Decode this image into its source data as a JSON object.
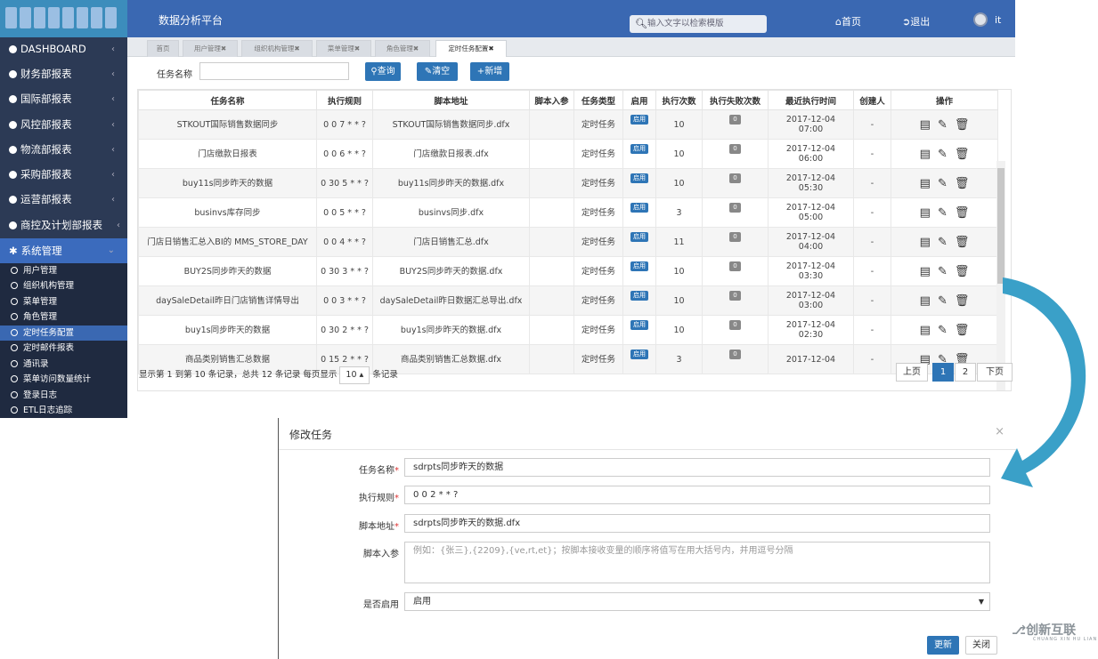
{
  "header": {
    "brand": "数据分析平台",
    "search_placeholder": "输入文字以检索模版",
    "home": "首页",
    "logout": "退出",
    "user": "it"
  },
  "sidebar": {
    "items": [
      {
        "label": "DASHBOARD"
      },
      {
        "label": "财务部报表"
      },
      {
        "label": "国际部报表"
      },
      {
        "label": "风控部报表"
      },
      {
        "label": "物流部报表"
      },
      {
        "label": "采购部报表"
      },
      {
        "label": "运营部报表"
      },
      {
        "label": "商控及计划部报表"
      },
      {
        "label": "系统管理"
      }
    ],
    "sub_items": [
      {
        "label": "用户管理"
      },
      {
        "label": "组织机构管理"
      },
      {
        "label": "菜单管理"
      },
      {
        "label": "角色管理"
      },
      {
        "label": "定时任务配置"
      },
      {
        "label": "定时邮件报表"
      },
      {
        "label": "通讯录"
      },
      {
        "label": "菜单访问数量统计"
      },
      {
        "label": "登录日志"
      },
      {
        "label": "ETL日志追踪"
      }
    ]
  },
  "tabs": [
    {
      "label": "首页"
    },
    {
      "label": "用户管理✖"
    },
    {
      "label": "组织机构管理✖"
    },
    {
      "label": "菜单管理✖"
    },
    {
      "label": "角色管理✖"
    },
    {
      "label": "定时任务配置✖"
    }
  ],
  "toolbar": {
    "label": "任务名称",
    "query": "查询",
    "clear": "清空",
    "add": "新增"
  },
  "table": {
    "headers": [
      "任务名称",
      "执行规则",
      "脚本地址",
      "脚本入参",
      "任务类型",
      "启用",
      "执行次数",
      "执行失败次数",
      "最近执行时间",
      "创建人",
      "操作"
    ],
    "rows": [
      {
        "name": "STKOUT国际销售数据同步",
        "rule": "0 0 7 * * ?",
        "script": "STKOUT国际销售数据同步.dfx",
        "param": "",
        "type": "定时任务",
        "enabled": "启用",
        "count": "10",
        "fail": "0",
        "last1": "2017-12-04",
        "last2": "07:00",
        "creator": "-"
      },
      {
        "name": "门店缴款日报表",
        "rule": "0 0 6 * * ?",
        "script": "门店缴款日报表.dfx",
        "param": "",
        "type": "定时任务",
        "enabled": "启用",
        "count": "10",
        "fail": "0",
        "last1": "2017-12-04",
        "last2": "06:00",
        "creator": "-"
      },
      {
        "name": "buy11s同步昨天的数据",
        "rule": "0 30 5 * * ?",
        "script": "buy11s同步昨天的数据.dfx",
        "param": "",
        "type": "定时任务",
        "enabled": "启用",
        "count": "10",
        "fail": "0",
        "last1": "2017-12-04",
        "last2": "05:30",
        "creator": "-"
      },
      {
        "name": "businvs库存同步",
        "rule": "0 0 5 * * ?",
        "script": "businvs同步.dfx",
        "param": "",
        "type": "定时任务",
        "enabled": "启用",
        "count": "3",
        "fail": "0",
        "last1": "2017-12-04",
        "last2": "05:00",
        "creator": "-"
      },
      {
        "name": "门店日销售汇总入BI的 MMS_STORE_DAY",
        "rule": "0 0 4 * * ?",
        "script": "门店日销售汇总.dfx",
        "param": "",
        "type": "定时任务",
        "enabled": "启用",
        "count": "11",
        "fail": "0",
        "last1": "2017-12-04",
        "last2": "04:00",
        "creator": "-"
      },
      {
        "name": "BUY2S同步昨天的数据",
        "rule": "0 30 3 * * ?",
        "script": "BUY2S同步昨天的数据.dfx",
        "param": "",
        "type": "定时任务",
        "enabled": "启用",
        "count": "10",
        "fail": "0",
        "last1": "2017-12-04",
        "last2": "03:30",
        "creator": "-"
      },
      {
        "name": "daySaleDetail昨日门店销售详情导出",
        "rule": "0 0 3 * * ?",
        "script": "daySaleDetail昨日数据汇总导出.dfx",
        "param": "",
        "type": "定时任务",
        "enabled": "启用",
        "count": "10",
        "fail": "0",
        "last1": "2017-12-04",
        "last2": "03:00",
        "creator": "-"
      },
      {
        "name": "buy1s同步昨天的数据",
        "rule": "0 30 2 * * ?",
        "script": "buy1s同步昨天的数据.dfx",
        "param": "",
        "type": "定时任务",
        "enabled": "启用",
        "count": "10",
        "fail": "0",
        "last1": "2017-12-04",
        "last2": "02:30",
        "creator": "-"
      },
      {
        "name": "商品类别销售汇总数据",
        "rule": "0 15 2 * * ?",
        "script": "商品类别销售汇总数据.dfx",
        "param": "",
        "type": "定时任务",
        "enabled": "启用",
        "count": "3",
        "fail": "0",
        "last1": "2017-12-04",
        "last2": "",
        "creator": "-"
      }
    ]
  },
  "pager": {
    "info_prefix": "显示第 1 到第 10 条记录，总共 12 条记录 每页显示",
    "page_size": "10 ▴",
    "info_suffix": "条记录",
    "prev": "上页",
    "page1": "1",
    "page2": "2",
    "next": "下页"
  },
  "modal": {
    "title": "修改任务",
    "close": "×",
    "name_label": "任务名称",
    "name_value": "sdrpts同步昨天的数据",
    "rule_label": "执行规则",
    "rule_value": "0 0 2 * * ?",
    "script_label": "脚本地址",
    "script_value": "sdrpts同步昨天的数据.dfx",
    "param_label": "脚本入参",
    "param_placeholder": "例如：{张三},{2209},{ve,rt,et}；按脚本接收变量的顺序将值写在用大括号内，并用逗号分隔",
    "enabled_label": "是否启用",
    "enabled_value": "启用",
    "update": "更新",
    "cancel": "关闭",
    "required": "*"
  },
  "watermark": {
    "text": "创新互联",
    "sub": "CHUANG XIN HU LIAN"
  },
  "colors": {
    "topbar": "#3a68b2",
    "sidebar": "#2c3a55",
    "accent": "#2e75b6",
    "arrow": "#3aa0c8"
  }
}
